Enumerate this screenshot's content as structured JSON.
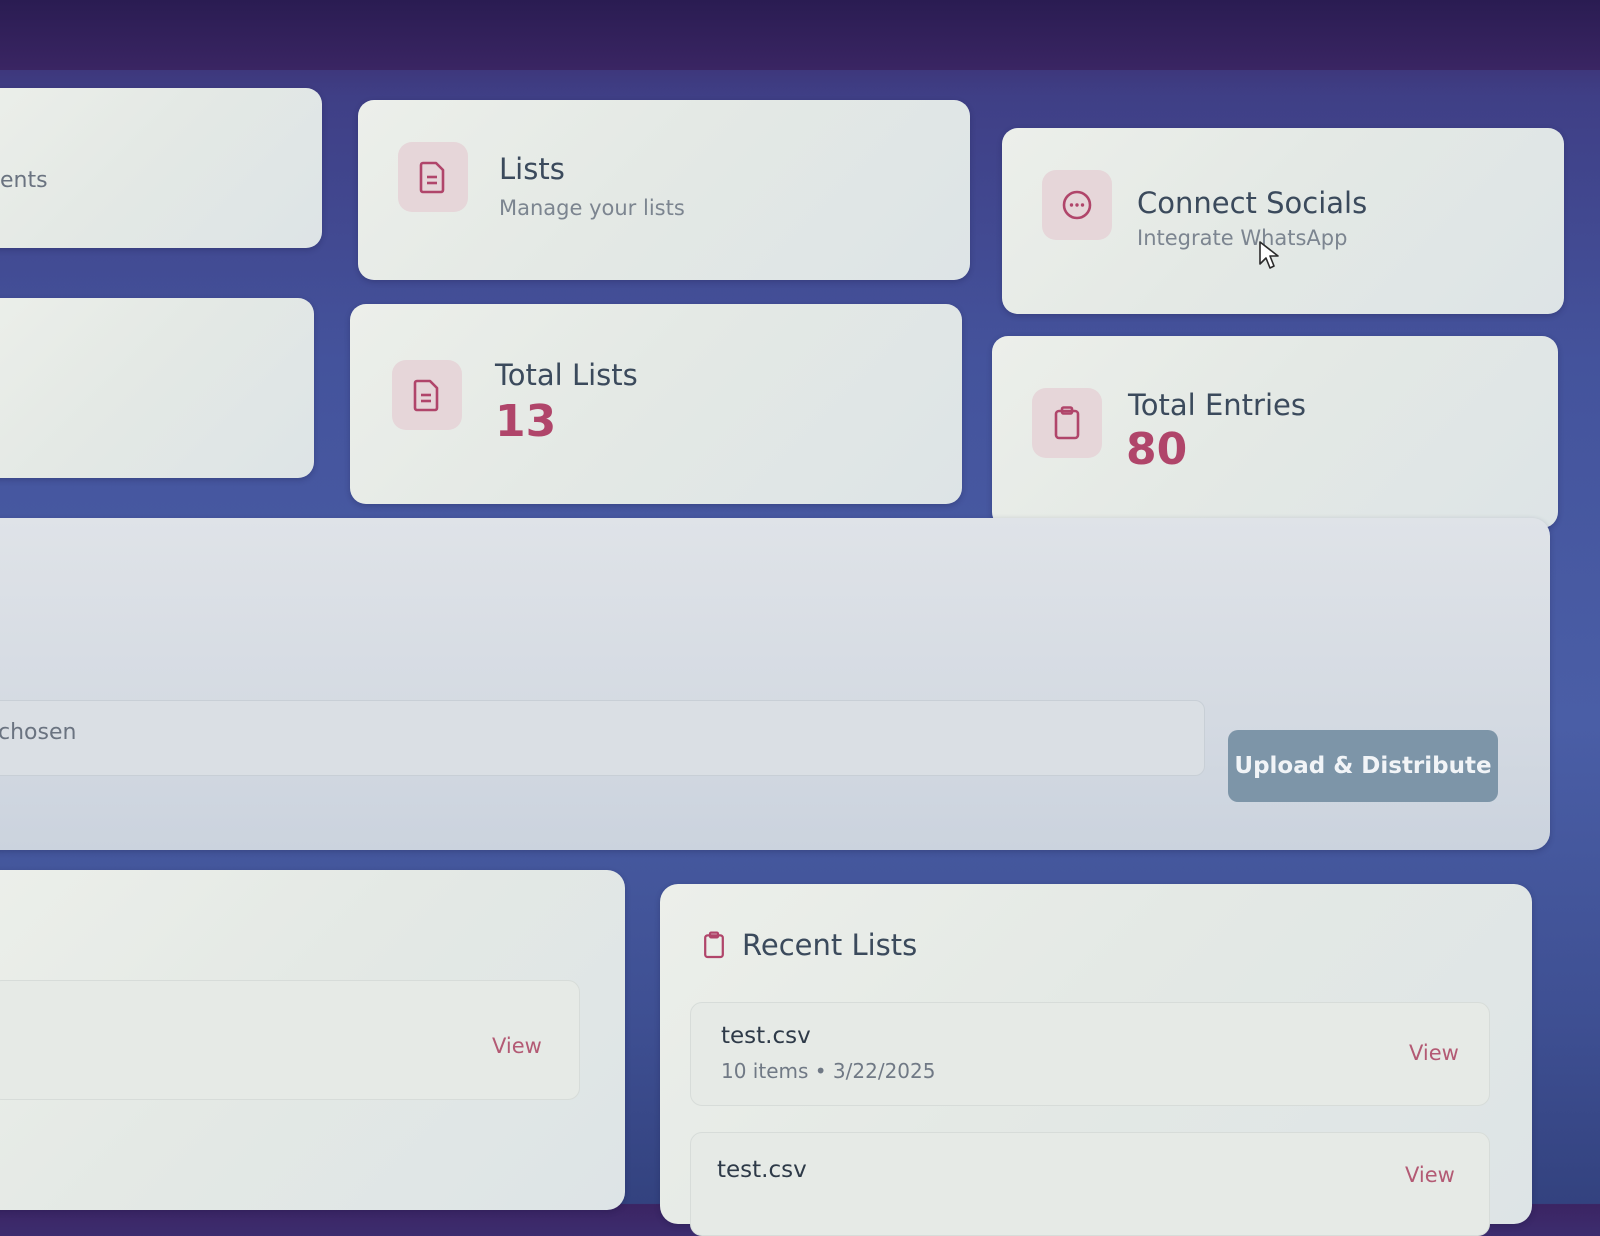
{
  "nav_cards": [
    {
      "partial_label": "ents"
    },
    {
      "title": "Lists",
      "subtitle": "Manage your lists",
      "icon": "document-icon"
    },
    {
      "title": "Connect Socials",
      "subtitle": "Integrate WhatsApp",
      "icon": "chat-bubble-icon"
    }
  ],
  "stats": [
    {
      "title": "Total Lists",
      "value": "13",
      "icon": "document-icon"
    },
    {
      "title": "Total Entries",
      "value": "80",
      "icon": "clipboard-icon"
    }
  ],
  "upload": {
    "file_status_partial": "chosen",
    "button_label": "Upload & Distribute"
  },
  "left_panel": {
    "view_label": "View"
  },
  "recent_lists": {
    "title": "Recent Lists",
    "icon": "clipboard-icon",
    "items": [
      {
        "name": "test.csv",
        "meta": "10 items • 3/22/2025",
        "action": "View"
      },
      {
        "name": "test.csv",
        "meta": "",
        "action": "View"
      }
    ]
  },
  "colors": {
    "accent": "#b0456a",
    "icon_bg": "#e6d6d9",
    "button_bg": "#7d95a8",
    "background": "#44539c"
  }
}
